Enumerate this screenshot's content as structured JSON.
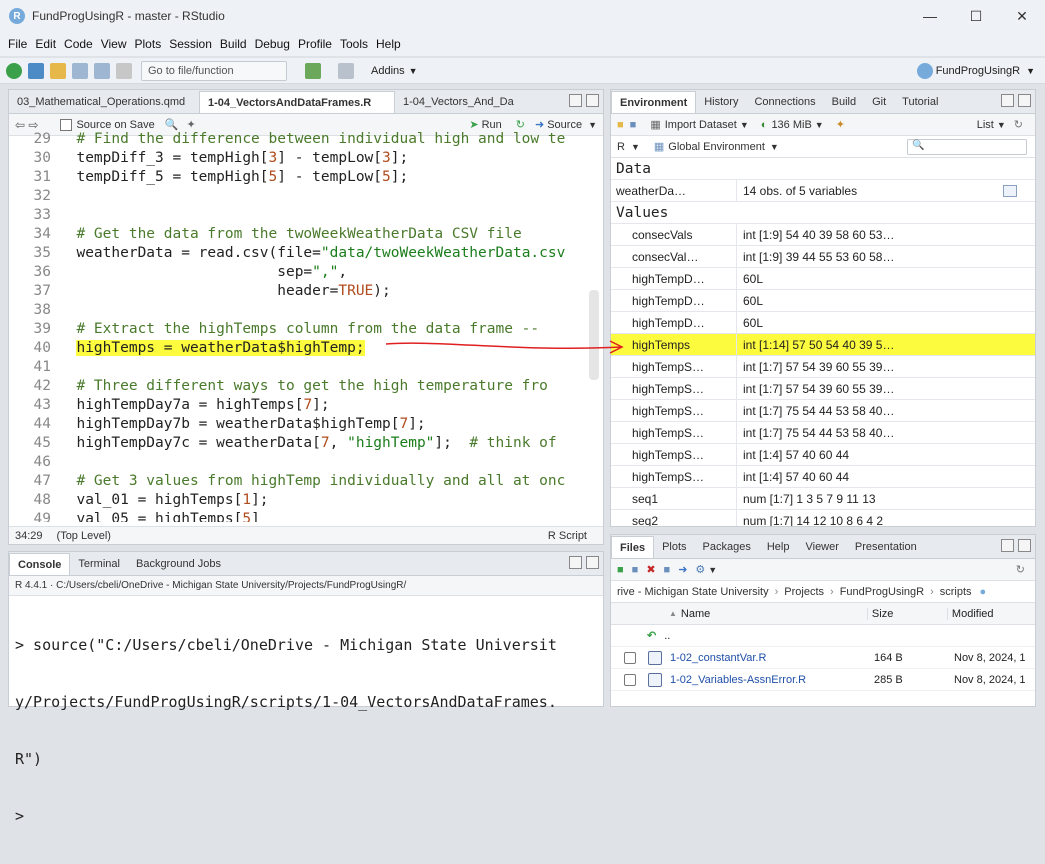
{
  "window": {
    "title": "FundProgUsingR - master - RStudio"
  },
  "menu": [
    "File",
    "Edit",
    "Code",
    "View",
    "Plots",
    "Session",
    "Build",
    "Debug",
    "Profile",
    "Tools",
    "Help"
  ],
  "toolbar": {
    "goto_placeholder": "Go to file/function",
    "addins": "Addins",
    "project": "FundProgUsingR"
  },
  "editor": {
    "tabs": [
      "03_Mathematical_Operations.qmd",
      "1-04_VectorsAndDataFrames.R",
      "1-04_Vectors_And_Da"
    ],
    "source_on_save": "Source on Save",
    "run": "Run",
    "source": "Source",
    "lines": [
      {
        "n": "29",
        "parts": [
          {
            "t": "  # Find the difference between individual high and low te",
            "c": "cm"
          }
        ]
      },
      {
        "n": "30",
        "parts": [
          {
            "t": "  tempDiff_3 = tempHigh[",
            "c": ""
          },
          {
            "t": "3",
            "c": "num"
          },
          {
            "t": "] - tempLow[",
            "c": ""
          },
          {
            "t": "3",
            "c": "num"
          },
          {
            "t": "];",
            "c": ""
          }
        ]
      },
      {
        "n": "31",
        "parts": [
          {
            "t": "  tempDiff_5 = tempHigh[",
            "c": ""
          },
          {
            "t": "5",
            "c": "num"
          },
          {
            "t": "] - tempLow[",
            "c": ""
          },
          {
            "t": "5",
            "c": "num"
          },
          {
            "t": "];",
            "c": ""
          }
        ]
      },
      {
        "n": "32",
        "parts": []
      },
      {
        "n": "33",
        "parts": []
      },
      {
        "n": "34",
        "parts": [
          {
            "t": "  # Get the data from the twoWeekWeatherData CSV file",
            "c": "cm"
          }
        ]
      },
      {
        "n": "35",
        "parts": [
          {
            "t": "  weatherData = read.csv(file=",
            "c": ""
          },
          {
            "t": "\"data/twoWeekWeatherData.csv",
            "c": "str"
          }
        ]
      },
      {
        "n": "36",
        "parts": [
          {
            "t": "                         sep=",
            "c": ""
          },
          {
            "t": "\",\"",
            "c": "str"
          },
          {
            "t": ",",
            "c": ""
          }
        ]
      },
      {
        "n": "37",
        "parts": [
          {
            "t": "                         header=",
            "c": ""
          },
          {
            "t": "TRUE",
            "c": "num"
          },
          {
            "t": ");",
            "c": ""
          }
        ]
      },
      {
        "n": "38",
        "parts": []
      },
      {
        "n": "39",
        "parts": [
          {
            "t": "  # Extract the highTemps column from the data frame --",
            "c": "cm"
          }
        ]
      },
      {
        "n": "40",
        "parts": [
          {
            "t": "highTemps = weatherData$highTemp;",
            "c": "hl"
          }
        ],
        "prefix": "  "
      },
      {
        "n": "41",
        "parts": []
      },
      {
        "n": "42",
        "parts": [
          {
            "t": "  # Three different ways to get the high temperature fro",
            "c": "cm"
          }
        ]
      },
      {
        "n": "43",
        "parts": [
          {
            "t": "  highTempDay7a = highTemps[",
            "c": ""
          },
          {
            "t": "7",
            "c": "num"
          },
          {
            "t": "];",
            "c": ""
          }
        ]
      },
      {
        "n": "44",
        "parts": [
          {
            "t": "  highTempDay7b = weatherData$highTemp[",
            "c": ""
          },
          {
            "t": "7",
            "c": "num"
          },
          {
            "t": "];",
            "c": ""
          }
        ]
      },
      {
        "n": "45",
        "parts": [
          {
            "t": "  highTempDay7c = weatherData[",
            "c": ""
          },
          {
            "t": "7",
            "c": "num"
          },
          {
            "t": ", ",
            "c": ""
          },
          {
            "t": "\"highTemp\"",
            "c": "str"
          },
          {
            "t": "];  ",
            "c": ""
          },
          {
            "t": "# think of",
            "c": "cm"
          }
        ]
      },
      {
        "n": "46",
        "parts": []
      },
      {
        "n": "47",
        "parts": [
          {
            "t": "  # Get 3 values from highTemp individually and all at onc",
            "c": "cm"
          }
        ]
      },
      {
        "n": "48",
        "parts": [
          {
            "t": "  val_01 = highTemps[",
            "c": ""
          },
          {
            "t": "1",
            "c": "num"
          },
          {
            "t": "];",
            "c": ""
          }
        ]
      },
      {
        "n": "49",
        "parts": [
          {
            "t": "  val_05 = highTemps[",
            "c": ""
          },
          {
            "t": "5",
            "c": "num"
          },
          {
            "t": "]",
            "c": ""
          }
        ]
      }
    ],
    "status_pos": "34:29",
    "status_scope": "(Top Level)",
    "status_type": "R Script"
  },
  "console": {
    "tabs": [
      "Console",
      "Terminal",
      "Background Jobs"
    ],
    "path": "R 4.4.1 · C:/Users/cbeli/OneDrive - Michigan State University/Projects/FundProgUsingR/",
    "lines": [
      "> source(\"C:/Users/cbeli/OneDrive - Michigan State Universit",
      "y/Projects/FundProgUsingR/scripts/1-04_VectorsAndDataFrames.",
      "R\")",
      ">"
    ]
  },
  "environment": {
    "tabs": [
      "Environment",
      "History",
      "Connections",
      "Build",
      "Git",
      "Tutorial"
    ],
    "import_dataset": "Import Dataset",
    "memory": "136 MiB",
    "list_label": "List",
    "lang": "R",
    "scope": "Global Environment",
    "data_label": "Data",
    "values_label": "Values",
    "data_rows": [
      {
        "name": "weatherDa…",
        "value": "14 obs. of 5 variables"
      }
    ],
    "value_rows": [
      {
        "name": "consecVals",
        "value": "int [1:9] 54 40 39 58 60 53…"
      },
      {
        "name": "consecVal…",
        "value": "int [1:9] 39 44 55 53 60 58…"
      },
      {
        "name": "highTempD…",
        "value": "60L"
      },
      {
        "name": "highTempD…",
        "value": "60L"
      },
      {
        "name": "highTempD…",
        "value": "60L"
      },
      {
        "name": "highTemps",
        "value": "int [1:14] 57 50 54 40 39 5…",
        "highlight": true
      },
      {
        "name": "highTempS…",
        "value": "int [1:7] 57 54 39 60 55 39…"
      },
      {
        "name": "highTempS…",
        "value": "int [1:7] 57 54 39 60 55 39…"
      },
      {
        "name": "highTempS…",
        "value": "int [1:7] 75 54 44 53 58 40…"
      },
      {
        "name": "highTempS…",
        "value": "int [1:7] 75 54 44 53 58 40…"
      },
      {
        "name": "highTempS…",
        "value": "int [1:4] 57 40 60 44"
      },
      {
        "name": "highTempS…",
        "value": "int [1:4] 57 40 60 44"
      },
      {
        "name": "seq1",
        "value": "num [1:7] 1 3 5 7 9 11 13"
      },
      {
        "name": "seq2",
        "value": "num [1:7] 14 12 10 8 6 4 2"
      }
    ]
  },
  "files": {
    "tabs": [
      "Files",
      "Plots",
      "Packages",
      "Help",
      "Viewer",
      "Presentation"
    ],
    "breadcrumb": [
      "rive - Michigan State University",
      "Projects",
      "FundProgUsingR",
      "scripts"
    ],
    "col_name": "Name",
    "col_size": "Size",
    "col_modified": "Modified",
    "up": "..",
    "rows": [
      {
        "name": "1-02_constantVar.R",
        "size": "164 B",
        "modified": "Nov 8, 2024, 1"
      },
      {
        "name": "1-02_Variables-AssnError.R",
        "size": "285 B",
        "modified": "Nov 8, 2024, 1"
      }
    ]
  }
}
